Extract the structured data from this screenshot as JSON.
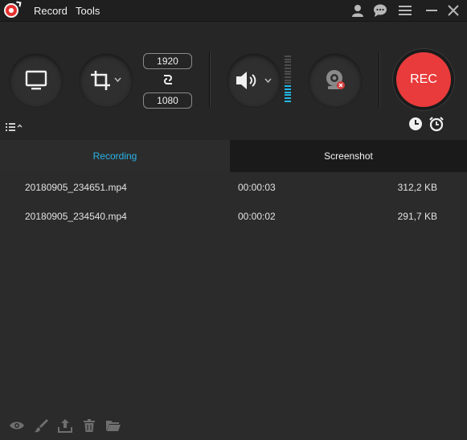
{
  "titlebar": {
    "menu": [
      {
        "label": "Record"
      },
      {
        "label": "Tools"
      }
    ]
  },
  "toolbar": {
    "width": "1920",
    "height": "1080",
    "rec_label": "REC",
    "audio_level": 0.35
  },
  "tabs": [
    {
      "label": "Recording",
      "active": true
    },
    {
      "label": "Screenshot",
      "active": false
    }
  ],
  "files": [
    {
      "name": "20180905_234651.mp4",
      "duration": "00:00:03",
      "size": "312,2 KB"
    },
    {
      "name": "20180905_234540.mp4",
      "duration": "00:00:02",
      "size": "291,7 KB"
    }
  ],
  "colors": {
    "accent": "#2bb4e8",
    "rec": "#e93b3b",
    "background": "#2b2b2b"
  }
}
